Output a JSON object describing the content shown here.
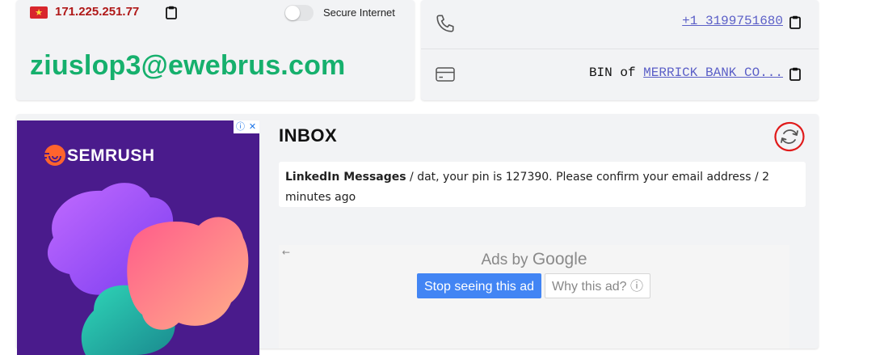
{
  "ip_panel": {
    "flag_country": "Vietnam",
    "flag_colors": {
      "red": "#d8262c",
      "star": "#ffdf3b"
    },
    "ip_address": "171.225.251.77",
    "secure_internet_label": "Secure Internet",
    "secure_internet_enabled": false,
    "email": "ziuslop3@ewebrus.com",
    "icons": [
      "flag-icon",
      "copy-icon",
      "toggle-switch"
    ]
  },
  "info_panel": {
    "phone": "+1 3199751680",
    "bin_prefix": "BIN of",
    "bin_bank": "MERRICK BANK CO...",
    "icons": [
      "phone-icon",
      "credit-card-icon",
      "copy-icon"
    ]
  },
  "ad_banner": {
    "brand": "SEMRUSH",
    "colors": {
      "background": "#4a1b8c",
      "flame": "#ff642d"
    },
    "ad_choices_icons": [
      "info-icon",
      "close-icon"
    ]
  },
  "inbox": {
    "title": "INBOX",
    "refresh_icon": "refresh-icon",
    "messages": [
      {
        "sender": "LinkedIn Messages",
        "separator_1": " / ",
        "subject": "dat, your pin is 127390. Please confirm your email address",
        "separator_2": " / ",
        "time": "2 minutes ago"
      }
    ]
  },
  "google_ad": {
    "back_arrow": "←",
    "ads_by": "Ads by",
    "google": "Google",
    "stop_button": "Stop seeing this ad",
    "why_button": "Why this ad? ⓘ"
  },
  "colors": {
    "email_green": "#16b06d",
    "ip_red": "#b01818",
    "link_purple": "#5b5fc7",
    "google_blue": "#4285f4",
    "annotation_red": "#e01a1a"
  }
}
